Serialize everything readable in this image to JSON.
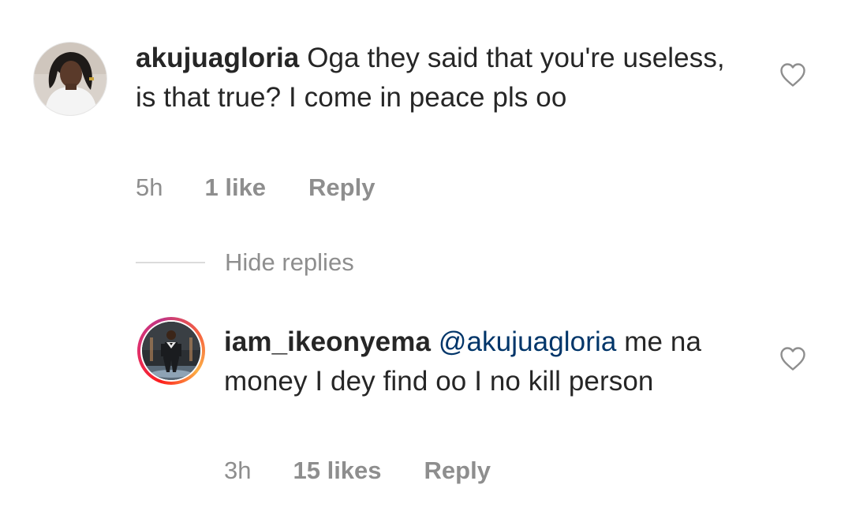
{
  "comment": {
    "username": "akujuagloria",
    "text": "Oga they said that you're useless, is that true? I come in peace pls oo",
    "time": "5h",
    "likes": "1 like",
    "reply_label": "Reply",
    "like_icon": "heart-outline-icon"
  },
  "thread": {
    "hide_replies_label": "Hide replies"
  },
  "reply": {
    "username": "iam_ikeonyema",
    "mention": "@akujuagloria",
    "text": "me na money I dey find oo I no kill person",
    "time": "3h",
    "likes": "15 likes",
    "reply_label": "Reply",
    "like_icon": "heart-outline-icon",
    "story_ring": true
  },
  "colors": {
    "text": "#262626",
    "meta": "#8e8e8e",
    "mention": "#003569",
    "divider": "#dbdbdb"
  }
}
